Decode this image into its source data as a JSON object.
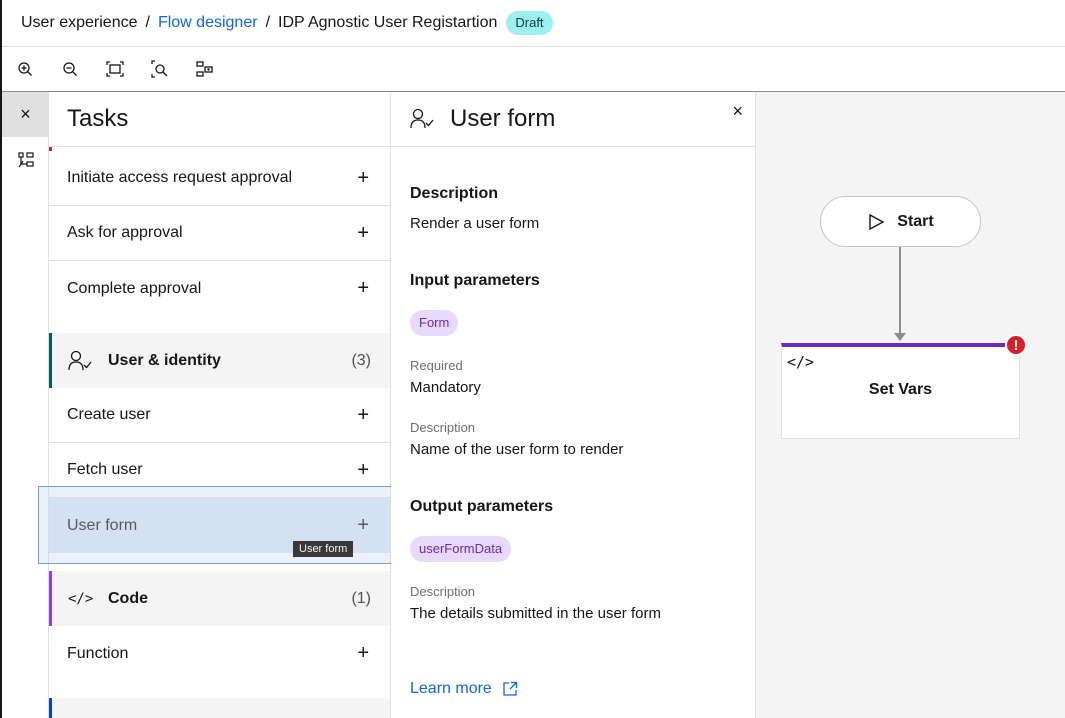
{
  "breadcrumb": {
    "root": "User experience",
    "separator": "/",
    "parent": "Flow designer",
    "current": "IDP Agnostic User Registartion",
    "status": "Draft"
  },
  "toolbar": {
    "icons": [
      "zoom-in-icon",
      "zoom-out-icon",
      "fit-to-screen-icon",
      "zoom-area-icon",
      "minimap-icon"
    ]
  },
  "rail": {
    "close_glyph": "×",
    "icons": [
      "close-icon",
      "flow-tasks-icon"
    ]
  },
  "tasks": {
    "title": "Tasks",
    "plus": "+",
    "items_top": [
      {
        "label": "Initiate access request approval"
      },
      {
        "label": "Ask for approval"
      },
      {
        "label": "Complete approval"
      }
    ],
    "category_user": {
      "label": "User & identity",
      "count": "(3)"
    },
    "items_user": [
      {
        "label": "Create user"
      },
      {
        "label": "Fetch user"
      },
      {
        "label": "User form"
      }
    ],
    "tooltip": "User form",
    "category_code": {
      "icon_text": "</>",
      "label": "Code",
      "count": "(1)"
    },
    "items_code": [
      {
        "label": "Function"
      }
    ]
  },
  "details": {
    "title": "User form",
    "close": "×",
    "description_title": "Description",
    "description": "Render a user form",
    "input_title": "Input parameters",
    "input_tag": "Form",
    "required_label": "Required",
    "required_value": "Mandatory",
    "input_desc_label": "Description",
    "input_desc": "Name of the user form to render",
    "output_title": "Output parameters",
    "output_tag": "userFormData",
    "output_desc_label": "Description",
    "output_desc": "The details submitted in the user form",
    "learn_more": "Learn more"
  },
  "canvas": {
    "start_label": "Start",
    "node_code": "</>",
    "node_label": "Set Vars",
    "error_glyph": "!"
  },
  "colors": {
    "link": "#0f62fe",
    "draft_badge": "#9ef0f0",
    "tag_bg": "#e8daff",
    "tag_text": "#6929c4",
    "error": "#da1e28"
  }
}
